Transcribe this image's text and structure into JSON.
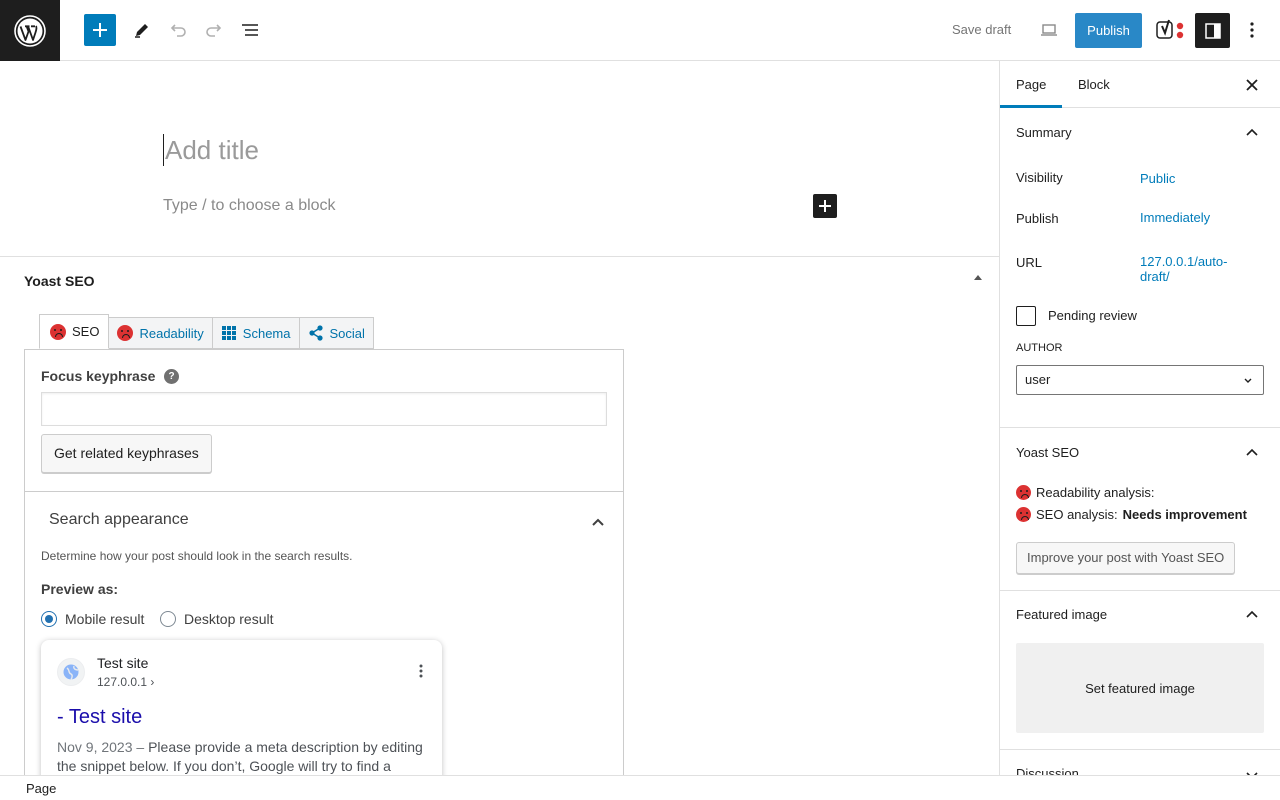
{
  "toolbar": {
    "save_draft": "Save draft",
    "publish": "Publish"
  },
  "editor": {
    "title_placeholder": "Add title",
    "block_placeholder": "Type / to choose a block"
  },
  "yoast_box": {
    "title": "Yoast SEO",
    "tabs": [
      {
        "label": "SEO",
        "icon": "sad-face-icon",
        "active": true
      },
      {
        "label": "Readability",
        "icon": "sad-face-icon",
        "active": false
      },
      {
        "label": "Schema",
        "icon": "grid-icon",
        "active": false
      },
      {
        "label": "Social",
        "icon": "share-icon",
        "active": false
      }
    ],
    "focus_keyphrase_label": "Focus keyphrase",
    "focus_keyphrase_value": "",
    "related_button": "Get related keyphrases",
    "search_appearance": {
      "title": "Search appearance",
      "description": "Determine how your post should look in the search results.",
      "preview_as": "Preview as:",
      "options": [
        "Mobile result",
        "Desktop result"
      ],
      "selected": "Mobile result"
    },
    "serp": {
      "site_name": "Test site",
      "url": "127.0.0.1 ›",
      "title": "- Test site",
      "date": "Nov 9, 2023",
      "separator": " – ",
      "description": "Please provide a meta description by editing the snippet below. If you don’t, Google will try to find a relevant part of your post to show in the search results."
    }
  },
  "sidebar": {
    "tabs": [
      "Page",
      "Block"
    ],
    "summary": {
      "title": "Summary",
      "visibility_label": "Visibility",
      "visibility_value": "Public",
      "publish_label": "Publish",
      "publish_value": "Immediately",
      "url_label": "URL",
      "url_value": "127.0.0.1/auto-draft/",
      "pending_label": "Pending review",
      "author_label": "AUTHOR",
      "author_value": "user"
    },
    "yoast": {
      "title": "Yoast SEO",
      "readability": "Readability analysis:",
      "seo_prefix": "SEO analysis:",
      "seo_status": "Needs improvement",
      "improve_button": "Improve your post with Yoast SEO"
    },
    "featured_image": {
      "title": "Featured image",
      "button": "Set featured image"
    },
    "discussion": {
      "title": "Discussion"
    }
  },
  "footer": {
    "breadcrumb": "Page"
  },
  "colors": {
    "accent": "#007cba",
    "publish": "#2988c7",
    "error": "#dc3232",
    "dark": "#1e1e1e"
  }
}
